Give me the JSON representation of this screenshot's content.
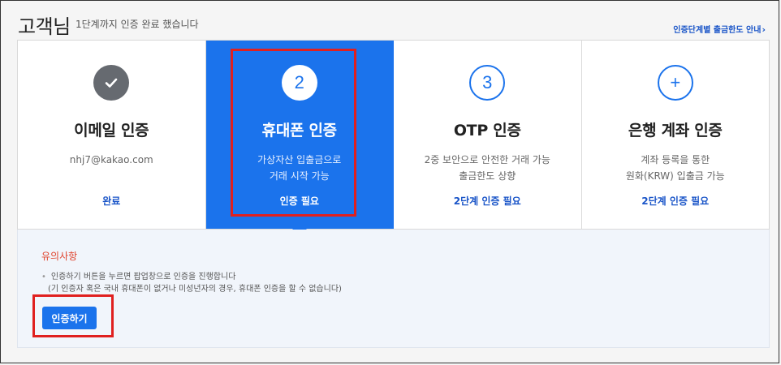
{
  "header": {
    "title": "고객님",
    "subtitle": "1단계까지 인증 완료 했습니다",
    "link_label": "인증단계별 출금한도 안내",
    "link_icon": "chevron-right-icon"
  },
  "steps": [
    {
      "badge": "✓",
      "badge_icon": "check-icon",
      "title": "이메일 인증",
      "desc1": "nhj7@kakao.com",
      "desc2": "",
      "status": "완료",
      "state": "done"
    },
    {
      "badge": "2",
      "title": "휴대폰 인증",
      "desc1": "가상자산 입출금으로",
      "desc2": "거래 시작 가능",
      "status": "인증 필요",
      "state": "active"
    },
    {
      "badge": "3",
      "title": "OTP 인증",
      "desc1": "2중 보안으로 안전한 거래 가능",
      "desc2": "출금한도 상향",
      "status": "2단계 인증 필요",
      "state": "pending"
    },
    {
      "badge": "+",
      "badge_icon": "plus-icon",
      "title": "은행 계좌 인증",
      "desc1": "계좌 등록을 통한",
      "desc2": "원화(KRW) 입출금 가능",
      "status": "2단계 인증 필요",
      "state": "pending"
    }
  ],
  "notice": {
    "title": "유의사항",
    "line1": "인증하기 버튼을 누르면 팝업창으로 인증을 진행합니다",
    "line2": "(기 인증자 혹은 국내 휴대폰이 없거나 미성년자의 경우, 휴대폰 인증을 할 수 없습니다)",
    "button_label": "인증하기"
  },
  "colors": {
    "accent": "#1b73ec",
    "link": "#1a55c8",
    "warning": "#e0452f",
    "highlight": "#e0201f"
  }
}
